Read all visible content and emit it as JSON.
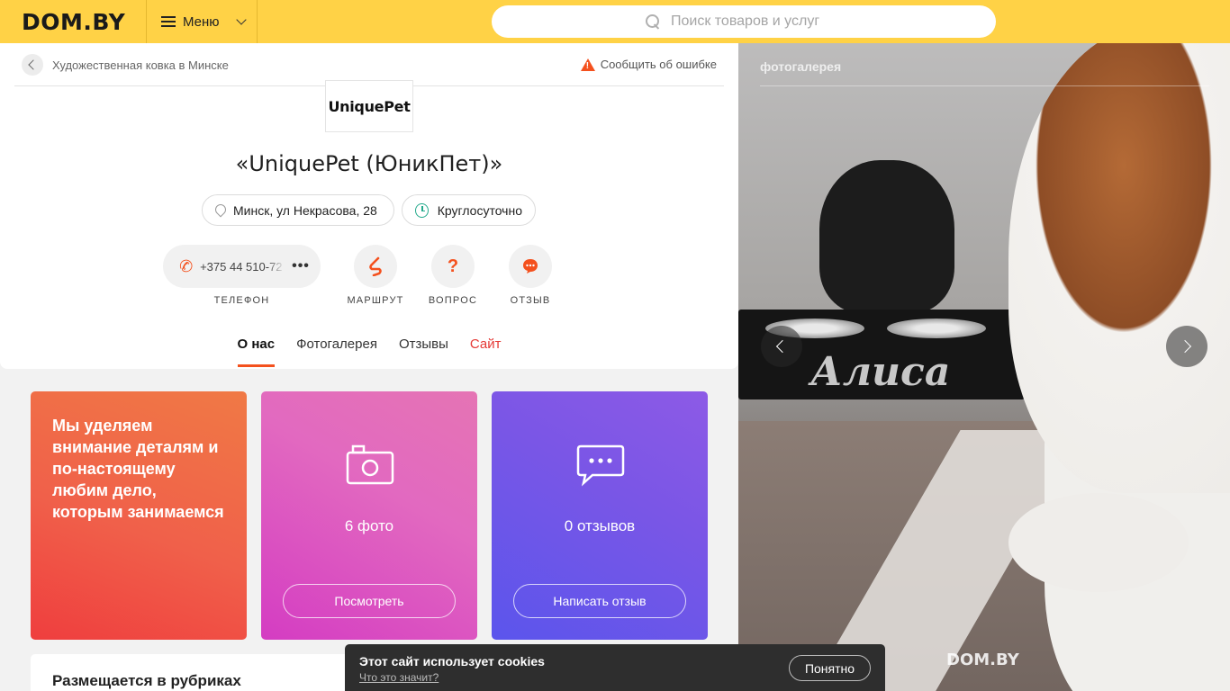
{
  "header": {
    "logo": "DOM.BY",
    "menu_label": "Меню",
    "search_placeholder": "Поиск товаров и услуг"
  },
  "breadcrumb": {
    "text": "Художественная ковка в Минске"
  },
  "report_label": "Сообщить об ошибке",
  "company": {
    "logo_text": "UniquePet",
    "title": "«UniquePet (ЮникПет)»",
    "address": "Минск, ул Некрасова, 28",
    "hours": "Круглосуточно",
    "phone": "+375 44 510-72"
  },
  "actions": {
    "phone_label": "ТЕЛЕФОН",
    "route_label": "МАРШРУТ",
    "question_label": "ВОПРОС",
    "review_label": "ОТЗЫВ"
  },
  "tabs": [
    {
      "label": "О нас"
    },
    {
      "label": "Фотогалерея"
    },
    {
      "label": "Отзывы"
    },
    {
      "label": "Сайт"
    }
  ],
  "tiles": {
    "quote": "Мы уделяем внимание деталям и по-настоящему любим дело, которым занимаемся",
    "photos_count": "6 фото",
    "photos_button": "Посмотреть",
    "reviews_count": "0 отзывов",
    "reviews_button": "Написать отзыв"
  },
  "rubrics": {
    "heading": "Размещается в рубриках"
  },
  "gallery": {
    "title": "фотогалерея",
    "photo_caption": "Алиса",
    "watermark": "DOM.BY"
  },
  "cookie": {
    "message": "Этот сайт использует cookies",
    "link": "Что это значит?",
    "accept": "Понятно"
  },
  "colors": {
    "header_bg": "#ffd246",
    "accent": "#f4511e",
    "site_link": "#e53935",
    "clock_green": "#23a98b"
  }
}
